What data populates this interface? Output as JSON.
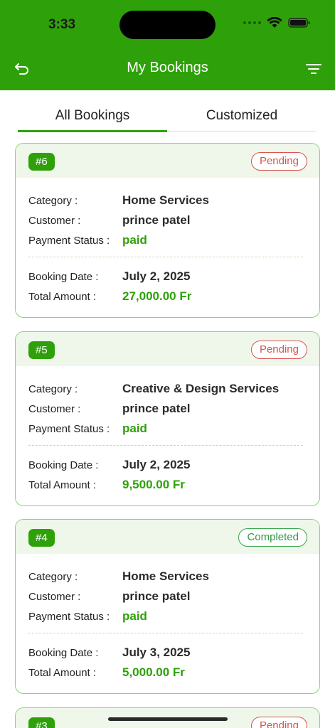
{
  "status_bar": {
    "time": "3:33"
  },
  "nav": {
    "title": "My Bookings"
  },
  "tabs": [
    {
      "label": "All Bookings",
      "active": true
    },
    {
      "label": "Customized",
      "active": false
    }
  ],
  "labels": {
    "category": "Category :",
    "customer": "Customer :",
    "payment_status": "Payment Status :",
    "booking_date": "Booking Date :",
    "total_amount": "Total Amount :"
  },
  "bookings": [
    {
      "id": "#6",
      "status": "Pending",
      "category": "Home Services",
      "customer": "prince patel",
      "payment_status": "paid",
      "booking_date": "July 2, 2025",
      "total_amount": "27,000.00 Fr"
    },
    {
      "id": "#5",
      "status": "Pending",
      "category": "Creative & Design Services",
      "customer": "prince patel",
      "payment_status": "paid",
      "booking_date": "July 2, 2025",
      "total_amount": "9,500.00 Fr"
    },
    {
      "id": "#4",
      "status": "Completed",
      "category": "Home Services",
      "customer": "prince patel",
      "payment_status": "paid",
      "booking_date": "July 3, 2025",
      "total_amount": "5,000.00 Fr"
    },
    {
      "id": "#3",
      "status": "Pending"
    }
  ],
  "colors": {
    "brand": "#2ea10a",
    "pending": "#d9534f",
    "completed": "#2e9a44"
  }
}
